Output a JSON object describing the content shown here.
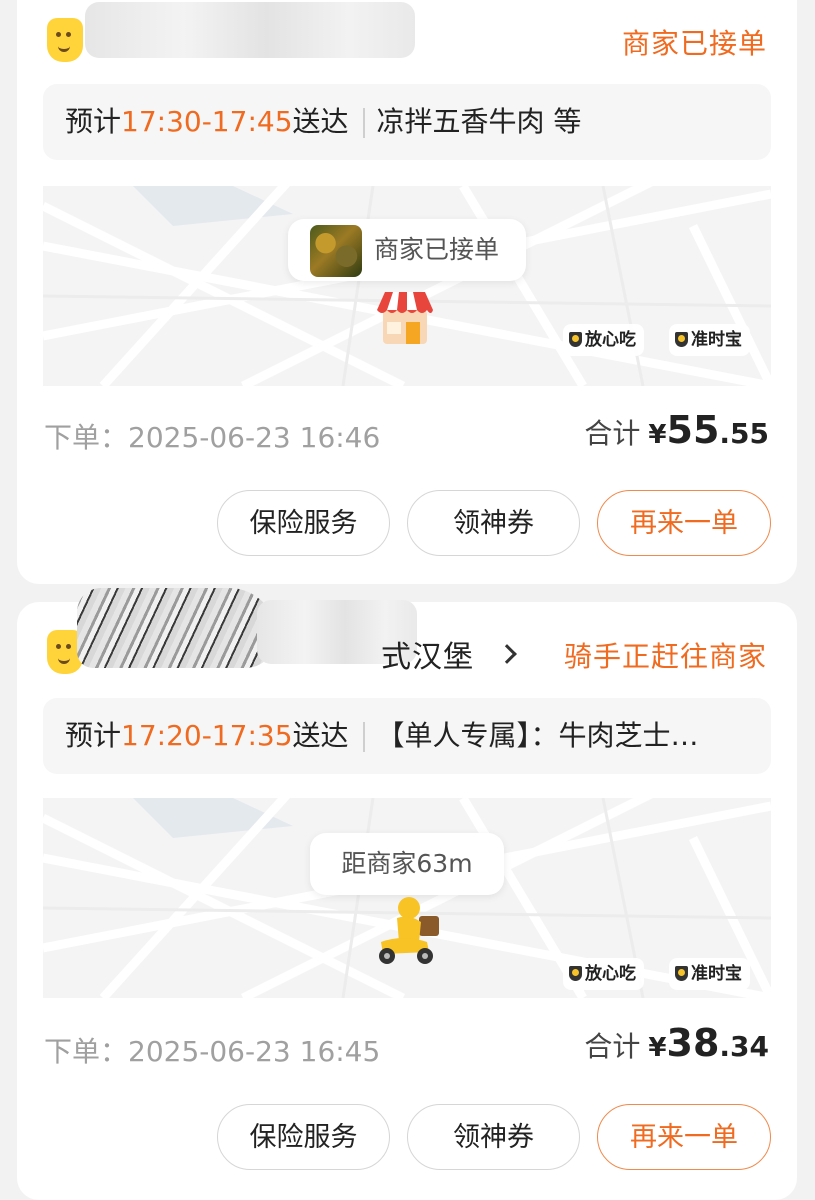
{
  "orders": [
    {
      "store_name": "",
      "status": "商家已接单",
      "eta_prefix": "预计",
      "eta_time": "17:30-17:45",
      "eta_suffix": "送达",
      "items": "凉拌五香牛肉 等",
      "map_bubble": "商家已接单",
      "map_marker_icon": "store-icon",
      "badges": [
        "放心吃",
        "准时宝"
      ],
      "order_time": "下单：2025-06-23 16:46",
      "total_label": "合计",
      "currency": "¥",
      "total_int": "55",
      "total_dec": ".55",
      "buttons": [
        "保险服务",
        "领神券",
        "再来一单"
      ]
    },
    {
      "store_name": "式汉堡",
      "status": "骑手正赶往商家",
      "eta_prefix": "预计",
      "eta_time": "17:20-17:35",
      "eta_suffix": "送达",
      "items": "【单人专属】：牛肉芝士…",
      "map_bubble": "距商家63m",
      "map_marker_icon": "rider-icon",
      "badges": [
        "放心吃",
        "准时宝"
      ],
      "order_time": "下单：2025-06-23 16:45",
      "total_label": "合计",
      "currency": "¥",
      "total_int": "38",
      "total_dec": ".34",
      "buttons": [
        "保险服务",
        "领神券",
        "再来一单"
      ]
    }
  ],
  "colors": {
    "accent": "#f06a1f",
    "muted": "#a0a0a0",
    "card": "#ffffff",
    "page": "#f2f2f2"
  }
}
